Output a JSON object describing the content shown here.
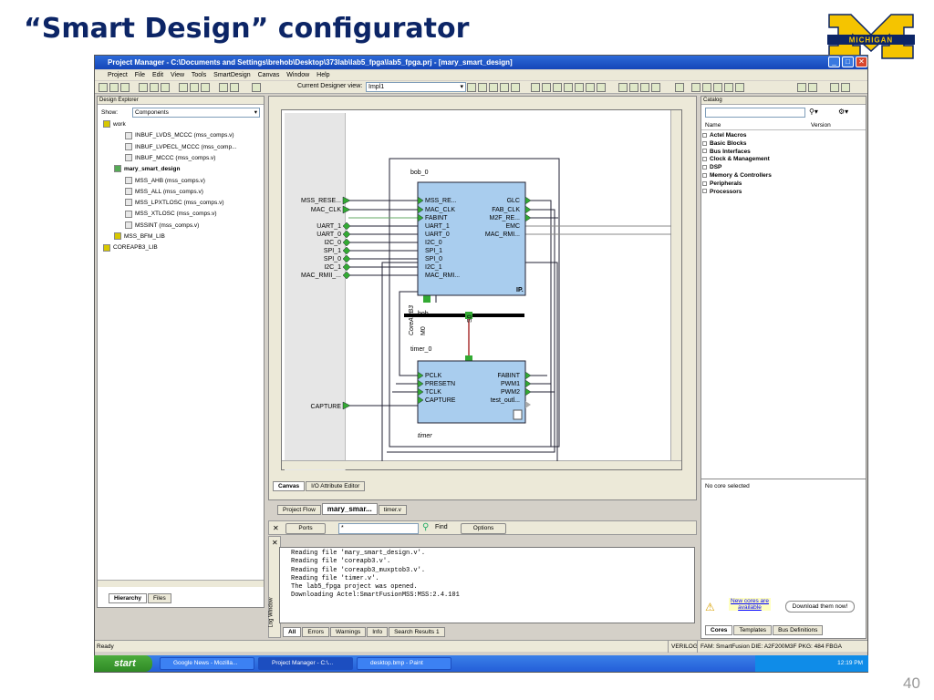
{
  "slide": {
    "title": "“Smart Design” configurator",
    "page_number": "40",
    "logo_text": "MICHIGAN"
  },
  "window": {
    "title": "Project Manager - C:\\Documents and Settings\\brehob\\Desktop\\373lab\\lab5_fpga\\lab5_fpga.prj - [mary_smart_design]",
    "menu": [
      "Project",
      "File",
      "Edit",
      "View",
      "Tools",
      "SmartDesign",
      "Canvas",
      "Window",
      "Help"
    ],
    "toolbar": {
      "current_view_label": "Current Designer view:",
      "current_view_value": "Impl1"
    },
    "status": "Ready",
    "status_right": [
      "VERILOG",
      "FAM: SmartFusion  DIE: A2F200M3F  PKG: 484 FBGA"
    ]
  },
  "design_explorer": {
    "header": "Design Explorer",
    "show_label": "Show:",
    "show_value": "Components",
    "items": [
      {
        "label": "work",
        "indent": 0,
        "type": "folder"
      },
      {
        "label": "INBUF_LVDS_MCCC (mss_comps.v)",
        "indent": 2,
        "type": "file"
      },
      {
        "label": "INBUF_LVPECL_MCCC (mss_comp...",
        "indent": 2,
        "type": "file"
      },
      {
        "label": "INBUF_MCCC (mss_comps.v)",
        "indent": 2,
        "type": "file"
      },
      {
        "label": "mary_smart_design",
        "indent": 1,
        "type": "design"
      },
      {
        "label": "MSS_AHB (mss_comps.v)",
        "indent": 2,
        "type": "file"
      },
      {
        "label": "MSS_ALL (mss_comps.v)",
        "indent": 2,
        "type": "file"
      },
      {
        "label": "MSS_LPXTLOSC (mss_comps.v)",
        "indent": 2,
        "type": "file"
      },
      {
        "label": "MSS_XTLOSC (mss_comps.v)",
        "indent": 2,
        "type": "file"
      },
      {
        "label": "MSSINT (mss_comps.v)",
        "indent": 2,
        "type": "file"
      },
      {
        "label": "MSS_BFM_LIB",
        "indent": 1,
        "type": "folder"
      },
      {
        "label": "COREAPB3_LIB",
        "indent": 0,
        "type": "folder"
      }
    ],
    "bottom_tabs": [
      "Hierarchy",
      "Files"
    ]
  },
  "canvas": {
    "bob": {
      "instance": "bob_0",
      "left_pins": [
        "MSS_RE...",
        "MAC_CLK",
        "FABINT",
        "UART_1",
        "UART_0",
        "I2C_0",
        "SPI_1",
        "SPI_0",
        "I2C_1",
        "MAC_RMI..."
      ],
      "right_pins": [
        "GLC",
        "FAB_CLK",
        "M2F_RE...",
        "EMC",
        "MAC_RMI..."
      ],
      "ip_tag": "IP."
    },
    "ports_left": [
      "MSS_RESE...",
      "MAC_CLK",
      "UART_1",
      "UART_0",
      "I2C_0",
      "SPI_1",
      "SPI_0",
      "I2C_1",
      "MAC_RMII_..."
    ],
    "bus": {
      "name": "CoreAPB3",
      "m0": "M0",
      "s0": "S0",
      "label": "bob"
    },
    "timer": {
      "instance": "timer_0",
      "left_pins": [
        "PCLK",
        "PRESETN",
        "TCLK",
        "CAPTURE"
      ],
      "right_pins": [
        "FABINT",
        "PWM1",
        "PWM2",
        "test_outl..."
      ],
      "footer": "timer"
    },
    "capture_port": "CAPTURE",
    "canvas_tabs": [
      "Canvas",
      "I/O Attribute Editor"
    ]
  },
  "doc_tabs": [
    "Project Flow",
    "mary_smar...",
    "timer.v"
  ],
  "log_toolbar": {
    "ports_label": "Ports",
    "search_value": "*",
    "find_label": "Find",
    "options_label": "Options"
  },
  "log": {
    "lines": [
      "Reading file 'mary_smart_design.v'.",
      "Reading file 'coreapb3.v'.",
      "Reading file 'coreapb3_muxptob3.v'.",
      "Reading file 'timer.v'.",
      "The lab5_fpga project was opened.",
      "Downloading Actel:SmartFusionMSS:MSS:2.4.101"
    ],
    "tabs": [
      "All",
      "Errors",
      "Warnings",
      "Info",
      "Search Results 1"
    ],
    "side_label": "Log Window"
  },
  "catalog": {
    "header": "Catalog",
    "columns": [
      "Name",
      "Version"
    ],
    "items": [
      "Actel Macros",
      "Basic Blocks",
      "Bus Interfaces",
      "Clock & Management",
      "DSP",
      "Memory & Controllers",
      "Peripherals",
      "Processors"
    ],
    "no_core": "No core selected",
    "new_cores_link": "New cores are available",
    "download_button": "Download them now!",
    "tabs": [
      "Cores",
      "Templates",
      "Bus Definitions"
    ]
  },
  "taskbar": {
    "start": "start",
    "tasks": [
      "Google News - Mozilla...",
      "Project Manager - C:\\...",
      "desktop.bmp - Paint"
    ],
    "clock": "12:19 PM"
  }
}
